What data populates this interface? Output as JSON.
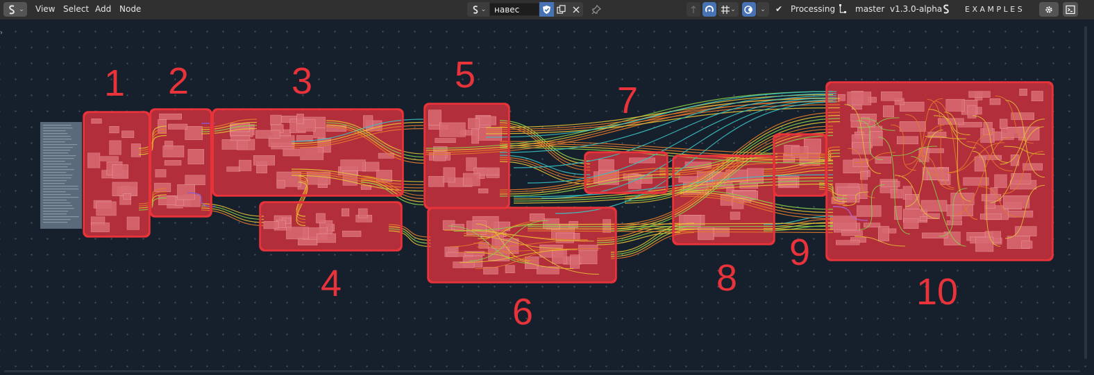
{
  "header": {
    "editor_type_icon": "sverchok-icon",
    "menus": [
      {
        "label": "View"
      },
      {
        "label": "Select"
      },
      {
        "label": "Add"
      },
      {
        "label": "Node"
      }
    ],
    "tree_name": "навес",
    "status_label": "Processing",
    "branch_label": "master",
    "version_label": "v1.3.0-alpha",
    "examples_label": "E X A M P L E S"
  },
  "frames": [
    {
      "number": "1"
    },
    {
      "number": "2"
    },
    {
      "number": "3"
    },
    {
      "number": "4"
    },
    {
      "number": "5"
    },
    {
      "number": "6"
    },
    {
      "number": "7"
    },
    {
      "number": "8"
    },
    {
      "number": "9"
    },
    {
      "number": "10"
    }
  ],
  "colors": {
    "canvas_bg": "#16202c",
    "highlight_red": "#e8333b",
    "frame_fill": "#c0303c",
    "node_fill": "#d86a73",
    "wire_yellow": "#e5c236",
    "wire_orange": "#e37a2c",
    "wire_cyan": "#38c3c3",
    "wire_green": "#8ccf4b"
  }
}
